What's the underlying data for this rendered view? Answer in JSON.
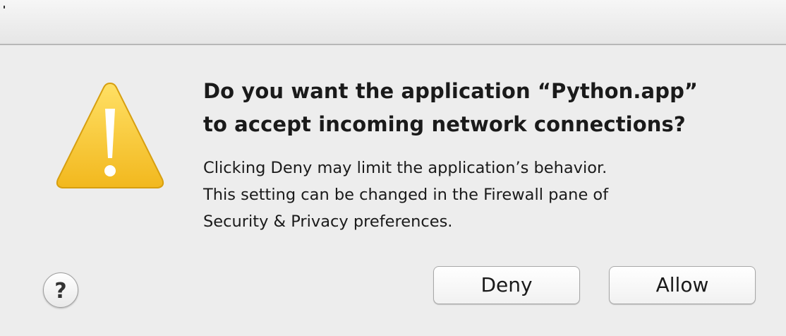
{
  "dialog": {
    "headline": "Do you want the application “Python.app”\nto accept incoming network connections?",
    "message": "Clicking Deny may limit the application’s behavior.\nThis setting can be changed in the Firewall pane of\nSecurity & Privacy preferences.",
    "icon": "warning-icon",
    "help_label": "?",
    "buttons": {
      "deny_label": "Deny",
      "allow_label": "Allow"
    }
  },
  "colors": {
    "background": "#ededed",
    "warning_fill": "#f7c52e",
    "warning_mark": "#ffffff"
  }
}
